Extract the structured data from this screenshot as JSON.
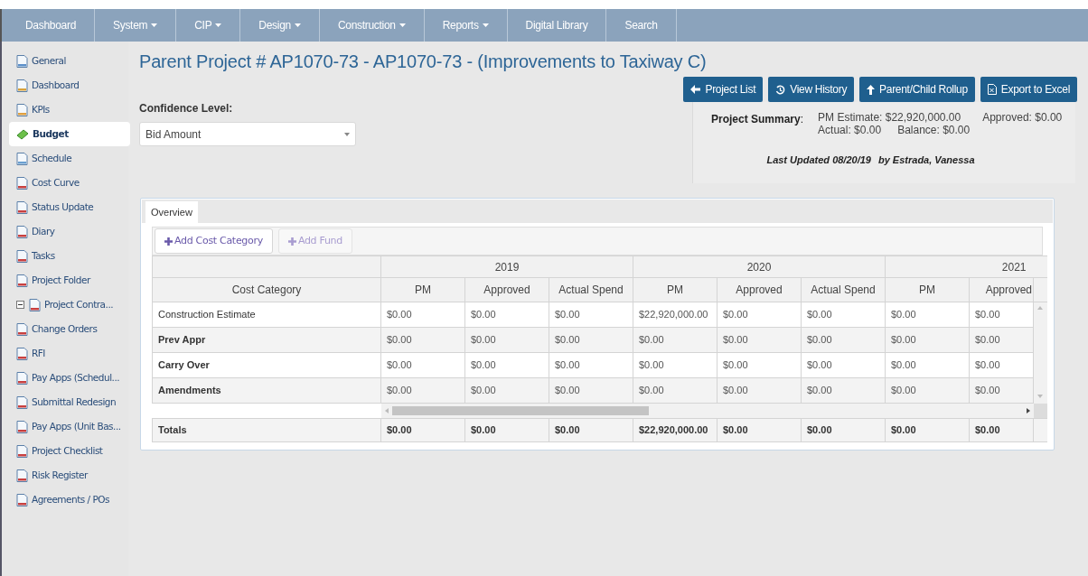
{
  "nav": [
    {
      "label": "Dashboard",
      "has_menu": false
    },
    {
      "label": "System",
      "has_menu": true
    },
    {
      "label": "CIP",
      "has_menu": true
    },
    {
      "label": "Design",
      "has_menu": true
    },
    {
      "label": "Construction",
      "has_menu": true
    },
    {
      "label": "Reports",
      "has_menu": true
    },
    {
      "label": "Digital Library",
      "has_menu": false
    },
    {
      "label": "Search",
      "has_menu": false
    }
  ],
  "sidebar": {
    "items": [
      {
        "label": "General",
        "selected": false
      },
      {
        "label": "Dashboard",
        "selected": false
      },
      {
        "label": "KPIs",
        "selected": false
      },
      {
        "label": "Budget",
        "selected": true
      },
      {
        "label": "Schedule",
        "selected": false
      },
      {
        "label": "Cost Curve",
        "selected": false
      },
      {
        "label": "Status Update",
        "selected": false
      },
      {
        "label": "Diary",
        "selected": false
      },
      {
        "label": "Tasks",
        "selected": false
      },
      {
        "label": "Project Folder",
        "selected": false
      },
      {
        "label": "Project Contra...",
        "selected": false,
        "expanded": true,
        "children": [
          {
            "label": "Change Orders",
            "selected": false
          },
          {
            "label": "RFI",
            "selected": false
          },
          {
            "label": "Pay Apps (Schedul...",
            "selected": false
          },
          {
            "label": "Submittal Redesign",
            "selected": false
          },
          {
            "label": "Pay Apps (Unit Bas...",
            "selected": false
          }
        ]
      },
      {
        "label": "Project Checklist",
        "selected": false
      },
      {
        "label": "Risk Register",
        "selected": false
      },
      {
        "label": "Agreements / POs",
        "selected": false
      }
    ]
  },
  "title": "Parent Project # AP1070-73 - AP1070-73 - (Improvements to Taxiway C)",
  "actions": [
    {
      "label": "Project List",
      "kind": "back"
    },
    {
      "label": "View History",
      "kind": "history"
    },
    {
      "label": "Parent/Child Rollup",
      "kind": "up"
    },
    {
      "label": "Export to Excel",
      "kind": "excel"
    }
  ],
  "confidence": {
    "label": "Confidence Level:",
    "value": "Bid Amount"
  },
  "summary": {
    "label": "**Project Summary**:",
    "pm_estimate": "PM Estimate: $22,920,000.00",
    "approved": "Approved: $0.00",
    "actual": "Actual: $0.00",
    "balance": "Balance: $0.00",
    "last_updated": "Last Updated 08/20/19",
    "by": "by Estrada, Vanessa"
  },
  "tabs": [
    {
      "label": "Overview",
      "selected": true
    }
  ],
  "toolbar": [
    {
      "label": "Add Cost Category",
      "disabled": false
    },
    {
      "label": "Add Fund",
      "disabled": true
    }
  ],
  "table": {
    "first_column": "Cost Category",
    "years": [
      {
        "label": "2019",
        "columns": [
          "PM",
          "Approved",
          "Actual Spend"
        ]
      },
      {
        "label": "2020",
        "columns": [
          "PM",
          "Approved",
          "Actual Spend"
        ]
      },
      {
        "label": "2021",
        "columns": [
          "PM",
          "Approved"
        ]
      }
    ],
    "rows": [
      {
        "label": "Construction Estimate",
        "bold": false,
        "values": [
          "$0.00",
          "$0.00",
          "$0.00",
          "$22,920,000.00",
          "$0.00",
          "$0.00",
          "$0.00",
          "$0.00"
        ]
      },
      {
        "label": "Prev Appr",
        "bold": true,
        "values": [
          "$0.00",
          "$0.00",
          "$0.00",
          "$0.00",
          "$0.00",
          "$0.00",
          "$0.00",
          "$0.00"
        ]
      },
      {
        "label": "Carry Over",
        "bold": true,
        "values": [
          "$0.00",
          "$0.00",
          "$0.00",
          "$0.00",
          "$0.00",
          "$0.00",
          "$0.00",
          "$0.00"
        ]
      },
      {
        "label": "Amendments",
        "bold": true,
        "values": [
          "$0.00",
          "$0.00",
          "$0.00",
          "$0.00",
          "$0.00",
          "$0.00",
          "$0.00",
          "$0.00"
        ]
      }
    ],
    "totals": {
      "label": "Totals",
      "values": [
        "$0.00",
        "$0.00",
        "$0.00",
        "$22,920,000.00",
        "$0.00",
        "$0.00",
        "$0.00",
        "$0.00"
      ]
    }
  }
}
